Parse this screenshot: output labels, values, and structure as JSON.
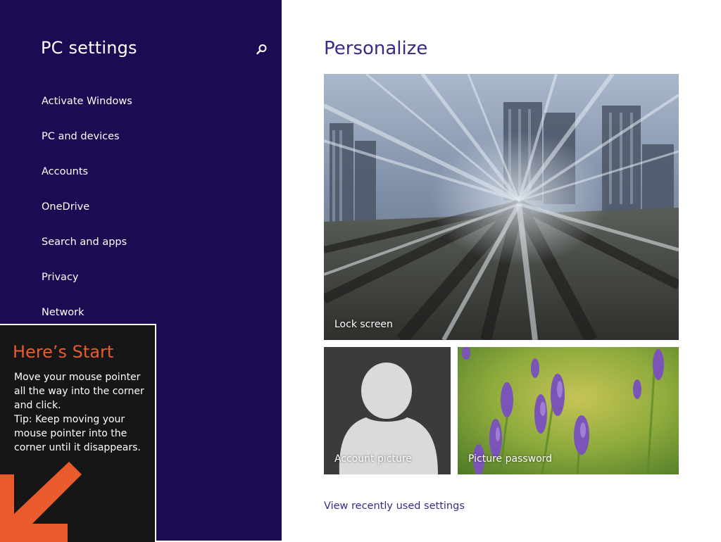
{
  "nav": {
    "title": "PC settings",
    "search_icon": "search-icon",
    "items": [
      {
        "label": "Activate Windows"
      },
      {
        "label": "PC and devices"
      },
      {
        "label": "Accounts"
      },
      {
        "label": "OneDrive"
      },
      {
        "label": "Search and apps"
      },
      {
        "label": "Privacy"
      },
      {
        "label": "Network"
      }
    ]
  },
  "start_tip": {
    "title": "Here’s Start",
    "body": "Move your mouse pointer\nall the way into the corner\nand click.\nTip: Keep moving your\nmouse pointer into the\ncorner until it disappears.",
    "arrow_icon": "arrow-down-left-icon"
  },
  "main": {
    "title": "Personalize",
    "tiles": {
      "lock_screen": "Lock screen",
      "account_picture": "Account picture",
      "picture_password": "Picture password"
    },
    "recent_link": "View recently used settings"
  },
  "colors": {
    "nav_background": "#1c0a52",
    "accent_text": "#3a2b86",
    "tip_title": "#e95b2c",
    "tip_background": "#161616"
  }
}
